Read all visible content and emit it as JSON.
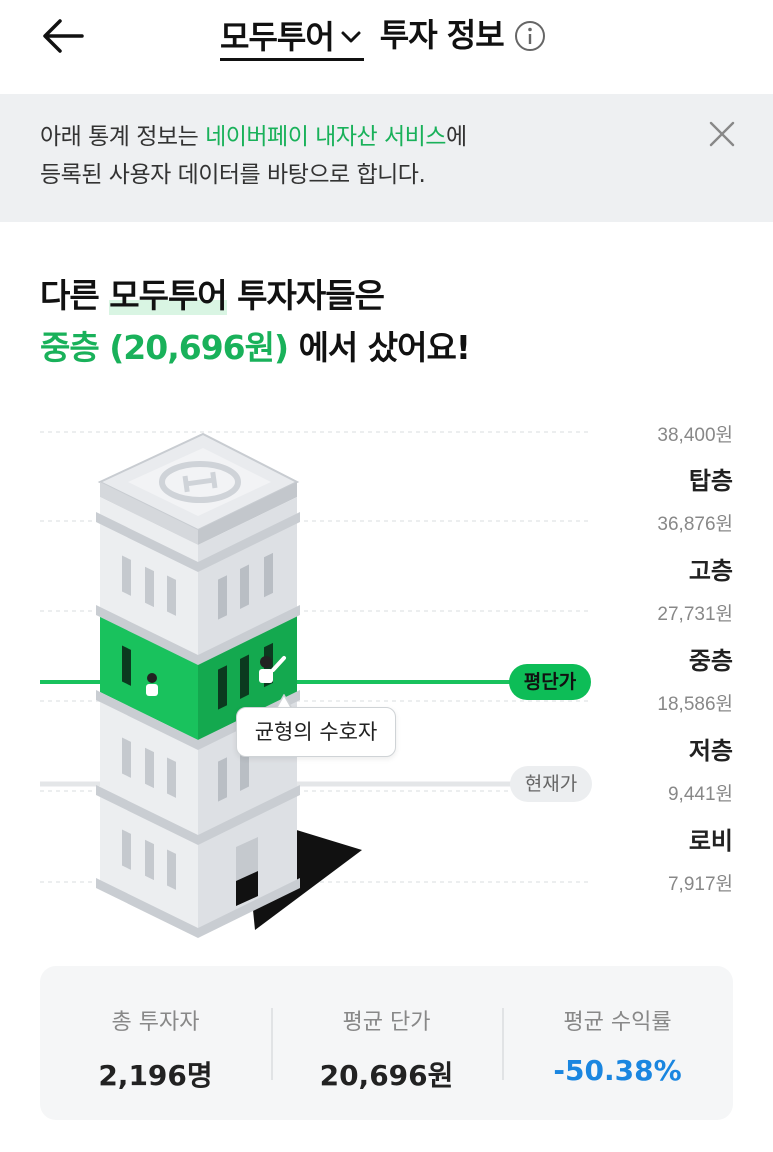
{
  "header": {
    "stock_name": "모두투어",
    "title_rest": "투자 정보"
  },
  "notice": {
    "part1": "아래 통계 정보는 ",
    "highlight": "네이버페이 내자산 서비스",
    "part2": "에",
    "line2": "등록된 사용자 데이터를 바탕으로 합니다."
  },
  "headline": {
    "line1_pre": "다른 ",
    "line1_mark": "모두투어",
    "line1_post": " 투자자들은",
    "line2_green": "중층 (20,696원)",
    "line2_post": " 에서 샀어요!"
  },
  "chart": {
    "prices": [
      "38,400원",
      "36,876원",
      "27,731원",
      "18,586원",
      "9,441원",
      "7,917원"
    ],
    "floors": [
      "탑층",
      "고층",
      "중층",
      "저층",
      "로비"
    ],
    "avg_label": "평단가",
    "current_label": "현재가",
    "bubble": "균형의 수호자",
    "accent_color": "#19b15a"
  },
  "stats": {
    "investors_label": "총 투자자",
    "investors_value": "2,196명",
    "avg_price_label": "평균 단가",
    "avg_price_value": "20,696원",
    "avg_return_label": "평균 수익률",
    "avg_return_value": "-50.38%",
    "return_color": "#1a86e0"
  }
}
